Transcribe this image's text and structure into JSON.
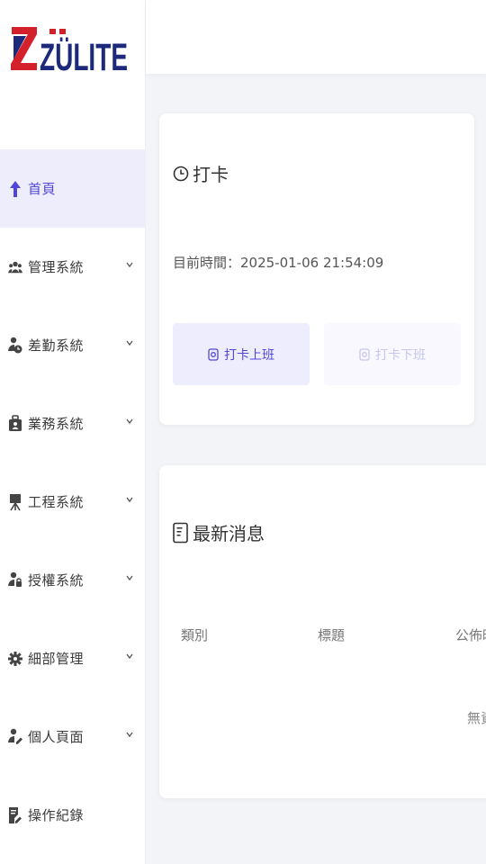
{
  "brand": {
    "logo_text": "ZÜLITE",
    "color": "#1d2a7c",
    "accent": "#d4202a"
  },
  "sidebar": {
    "items": [
      {
        "label": "首頁",
        "icon": "home-arrow-icon",
        "active": true
      },
      {
        "label": "管理系統",
        "icon": "users-icon",
        "expandable": true
      },
      {
        "label": "差勤系統",
        "icon": "user-clock-icon",
        "expandable": true
      },
      {
        "label": "業務系統",
        "icon": "briefcase-user-icon",
        "expandable": true
      },
      {
        "label": "工程系統",
        "icon": "easel-icon",
        "expandable": true
      },
      {
        "label": "授權系統",
        "icon": "user-key-icon",
        "expandable": true
      },
      {
        "label": "細部管理",
        "icon": "gear-icon",
        "expandable": true
      },
      {
        "label": "個人頁面",
        "icon": "user-edit-icon",
        "expandable": true
      },
      {
        "label": "操作紀錄",
        "icon": "file-edit-icon"
      }
    ]
  },
  "punch_card": {
    "title": "打卡",
    "time_label": "目前時間：2025-01-06 21:54:09",
    "clock_in_label": "打卡上班",
    "clock_out_label": "打卡下班"
  },
  "news_card": {
    "title": "最新消息",
    "columns": [
      "類別",
      "標題",
      "公佈時間"
    ],
    "empty_text": "無資料"
  },
  "colors": {
    "primary": "#5146d8",
    "active_bg": "#eeedfc"
  }
}
